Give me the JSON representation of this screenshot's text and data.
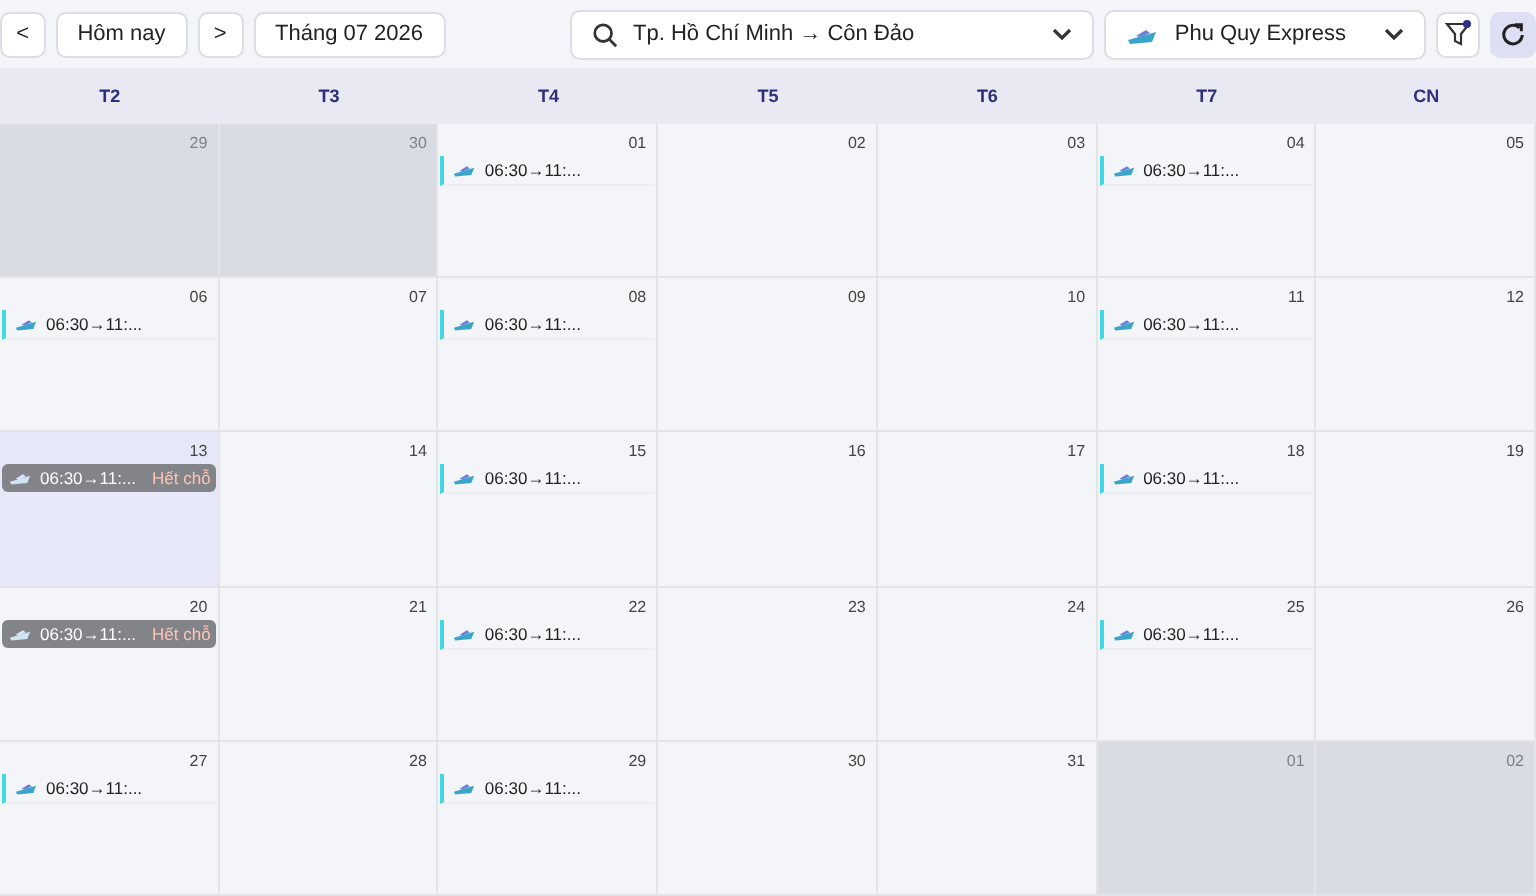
{
  "toolbar": {
    "prev": "<",
    "today": "Hôm nay",
    "next": ">",
    "month": "Tháng 07 2026",
    "route": "Tp. Hồ Chí Minh → Côn Đảo",
    "operator": "Phu Quy Express",
    "filter_active": true
  },
  "weekdays": [
    "T2",
    "T3",
    "T4",
    "T5",
    "T6",
    "T7",
    "CN"
  ],
  "weeks": [
    [
      {
        "day": "29",
        "muted": true,
        "highlighted": false
      },
      {
        "day": "30",
        "muted": true,
        "highlighted": false
      },
      {
        "day": "01",
        "muted": false,
        "highlighted": false,
        "events": [
          {
            "kind": "available",
            "time": "06:30→11:..."
          }
        ]
      },
      {
        "day": "02",
        "muted": false,
        "highlighted": false
      },
      {
        "day": "03",
        "muted": false,
        "highlighted": false
      },
      {
        "day": "04",
        "muted": false,
        "highlighted": false,
        "events": [
          {
            "kind": "available",
            "time": "06:30→11:..."
          }
        ]
      },
      {
        "day": "05",
        "muted": false,
        "highlighted": false
      }
    ],
    [
      {
        "day": "06",
        "muted": false,
        "highlighted": false,
        "events": [
          {
            "kind": "available",
            "time": "06:30→11:..."
          }
        ]
      },
      {
        "day": "07",
        "muted": false,
        "highlighted": false
      },
      {
        "day": "08",
        "muted": false,
        "highlighted": false,
        "events": [
          {
            "kind": "available",
            "time": "06:30→11:..."
          }
        ]
      },
      {
        "day": "09",
        "muted": false,
        "highlighted": false
      },
      {
        "day": "10",
        "muted": false,
        "highlighted": false
      },
      {
        "day": "11",
        "muted": false,
        "highlighted": false,
        "events": [
          {
            "kind": "available",
            "time": "06:30→11:..."
          }
        ]
      },
      {
        "day": "12",
        "muted": false,
        "highlighted": false
      }
    ],
    [
      {
        "day": "13",
        "muted": false,
        "highlighted": true,
        "events": [
          {
            "kind": "soldout",
            "time": "06:30→11:...",
            "status": "Hết chỗ"
          }
        ]
      },
      {
        "day": "14",
        "muted": false,
        "highlighted": false
      },
      {
        "day": "15",
        "muted": false,
        "highlighted": false,
        "events": [
          {
            "kind": "available",
            "time": "06:30→11:..."
          }
        ]
      },
      {
        "day": "16",
        "muted": false,
        "highlighted": false
      },
      {
        "day": "17",
        "muted": false,
        "highlighted": false
      },
      {
        "day": "18",
        "muted": false,
        "highlighted": false,
        "events": [
          {
            "kind": "available",
            "time": "06:30→11:..."
          }
        ]
      },
      {
        "day": "19",
        "muted": false,
        "highlighted": false
      }
    ],
    [
      {
        "day": "20",
        "muted": false,
        "highlighted": false,
        "events": [
          {
            "kind": "soldout",
            "time": "06:30→11:...",
            "status": "Hết chỗ"
          }
        ]
      },
      {
        "day": "21",
        "muted": false,
        "highlighted": false
      },
      {
        "day": "22",
        "muted": false,
        "highlighted": false,
        "events": [
          {
            "kind": "available",
            "time": "06:30→11:..."
          }
        ]
      },
      {
        "day": "23",
        "muted": false,
        "highlighted": false
      },
      {
        "day": "24",
        "muted": false,
        "highlighted": false
      },
      {
        "day": "25",
        "muted": false,
        "highlighted": false,
        "events": [
          {
            "kind": "available",
            "time": "06:30→11:..."
          }
        ]
      },
      {
        "day": "26",
        "muted": false,
        "highlighted": false
      }
    ],
    [
      {
        "day": "27",
        "muted": false,
        "highlighted": false,
        "events": [
          {
            "kind": "available",
            "time": "06:30→11:..."
          }
        ]
      },
      {
        "day": "28",
        "muted": false,
        "highlighted": false
      },
      {
        "day": "29",
        "muted": false,
        "highlighted": false,
        "events": [
          {
            "kind": "available",
            "time": "06:30→11:..."
          }
        ]
      },
      {
        "day": "30",
        "muted": false,
        "highlighted": false
      },
      {
        "day": "31",
        "muted": false,
        "highlighted": false
      },
      {
        "day": "01",
        "muted": true,
        "highlighted": false
      },
      {
        "day": "02",
        "muted": true,
        "highlighted": false
      }
    ]
  ]
}
